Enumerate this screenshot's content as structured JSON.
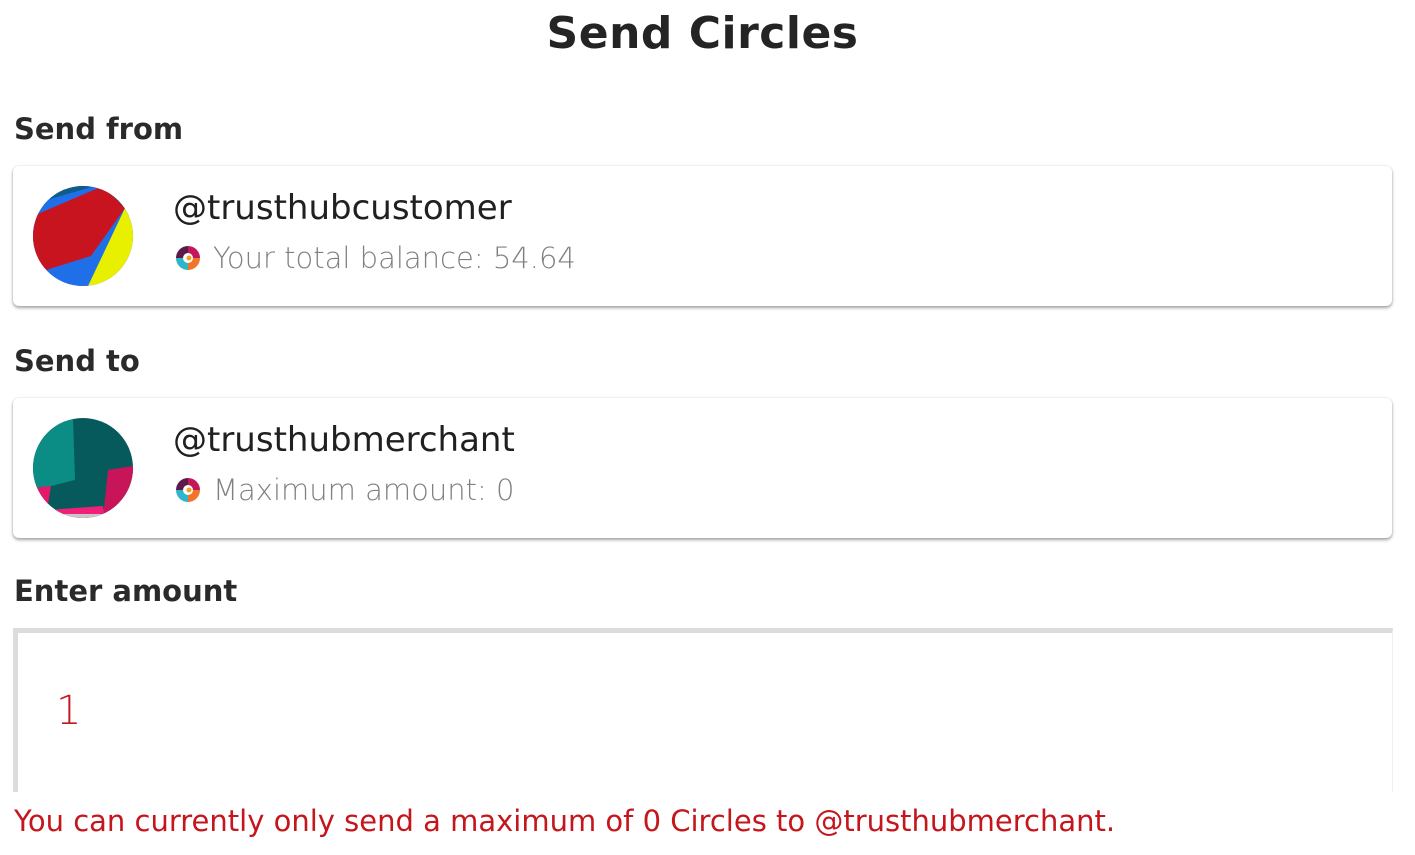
{
  "page": {
    "title": "Send Circles"
  },
  "send_from": {
    "label": "Send from",
    "username": "@trusthubcustomer",
    "balance_text": "Your total balance: 54.64",
    "icon": "circles-logo-icon",
    "avatar": "avatar-trusthubcustomer"
  },
  "send_to": {
    "label": "Send to",
    "username": "@trusthubmerchant",
    "max_text": "Maximum amount: 0",
    "icon": "circles-logo-icon",
    "avatar": "avatar-trusthubmerchant"
  },
  "amount": {
    "label": "Enter amount",
    "value": "1",
    "error": "You can currently only send a maximum of 0 Circles to @trusthubmerchant."
  },
  "colors": {
    "error": "#c4161c",
    "muted_text": "#808080",
    "heading": "#242424"
  }
}
